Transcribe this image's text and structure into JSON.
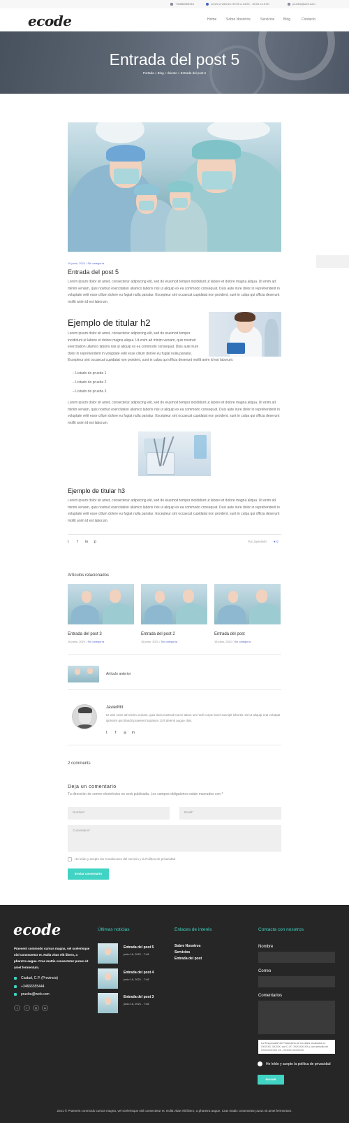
{
  "topbar": {
    "phone": "+34666555444",
    "hours": "Lunes a Viernes: 09:00 a 14:00 - 15:00 a 19:00",
    "email": "prueba@web.com"
  },
  "header": {
    "logo": "ecode",
    "nav": [
      "Home",
      "Sobre Nosotros",
      "Servicios",
      "Blog",
      "Contacto"
    ]
  },
  "hero": {
    "title": "Entrada del post 5",
    "breadcrumb": "Portada » Blog » Ilsiesto » Entrada del post 5"
  },
  "article": {
    "date": "16 junio, 2021",
    "category": "Sin categoría",
    "title": "Entrada del post 5",
    "lorem": "Lorem ipsum dolor sit amet, consectetur adipiscing elit, sed do eiusmod tempor incididunt ut labore et dolore magna aliqua. Ut enim ad minim veniam, quis nostrud exercitation ullamco laboris nisi ut aliquip ex ea commodo consequat. Duis aute irure dolor in reprehenderit in voluptate velit esse cillum dolore eu fugiat nulla pariatur. Excepteur sint occaecat cupidatat non proident, sunt in culpa qui officia deserunt mollit anim id est laborum.",
    "lorem_h2": "Lorem ipsum dolor sit amet, consectetur adipiscing elit, sed do eiusmod tempor incididunt ut labore et dolore magna aliqua. Ut enim ad minim veniam, quis nostrud exercitation ullamco laboris nisi ut aliquip ex ea commodo consequat. Duis aute irure dolor in reprehenderit in voluptate velit esse cillum dolore eu fugiat nulla pariatur. Excepteur sint occaecat cupidatat non proident, sunt in culpa qui officia deserunt mollit anim id est laborum.",
    "h2": "Ejemplo de titular h2",
    "list": [
      "Listado de prueba 1",
      "Listado de prueba 2",
      "Listado de prueba 3"
    ],
    "h3": "Ejemplo de titular h3",
    "author": "Por JavierMrt",
    "comment_count": "0"
  },
  "related": {
    "label": "Artículos relacionados",
    "items": [
      {
        "title": "Entrada del post 3",
        "date": "16 junio, 2021",
        "category": "Sin categoría"
      },
      {
        "title": "Entrada del post 2",
        "date": "16 junio, 2021",
        "category": "Sin categoría"
      },
      {
        "title": "Entrada del post",
        "date": "16 junio, 2021",
        "category": "Sin categoría"
      }
    ]
  },
  "prev": {
    "label": "Artículo anterior"
  },
  "author_box": {
    "name": "JavierMrt",
    "bio": "Ut wisi enim ad minim veniam, quis lacia nostrud exerci tation um hedi corper turet suscipit lobortis nisl ut aliquip erat volutpat ignissim qui blandit praesent luptatum zzril delenit augue duis."
  },
  "comments": {
    "count": "2 comments",
    "reply_title": "Deja un comentario",
    "note": "Tu dirección de correo electrónico no será publicada. Los campos obligatorios están marcados con *",
    "name_placeholder": "Nombre*",
    "email_placeholder": "Email*",
    "comment_placeholder": "Comentario*",
    "consent": "He leído y acepto las Condiciones del servicio y la Política de privacidad",
    "submit": "Enviar comentario"
  },
  "footer": {
    "logo": "ecode",
    "text": "Praesent commodo cursus magna, vel scelerisque nisl consectetur et. Nulla vitae elit libero, a pharetra augue. Cras mattis consectetur purus sit amet fermentum.",
    "city": "Ciudad, C.P. (Provincia)",
    "phone": "+34666555444",
    "email": "prueba@web.com",
    "news_head": "Últimas noticias",
    "news": [
      {
        "title": "Entrada del post 5",
        "date": "junio 16, 2021 - 7:48"
      },
      {
        "title": "Entrada del post 4",
        "date": "junio 16, 2021 - 7:48"
      },
      {
        "title": "Entrada del post 3",
        "date": "junio 16, 2021 - 7:48"
      }
    ],
    "links_head": "Enlaces de interés",
    "links": [
      "Sobre Nosotros",
      "Servicios",
      "Entrada del post"
    ],
    "contact_head": "Contacta con nosotros",
    "contact_labels": [
      "Nombre",
      "Correo",
      "Comentarios"
    ],
    "notice": "La Responsable del Tratamiento de los datos recabados es XXXXXX, XXXXX, con C.I.F.: XXXXXXXXX y con domicilio en XXXXXXXXXX XX - XXXXX XXXXXXX.",
    "consent": "He leído y acepto la política de privacidad",
    "submit": "ENVIAR",
    "copyright": "2021 © Praesent commodo cursus magna, vel scelerisque nisl consectetur et. Nulla vitae elit libero, a pharetra augue. Cras mattis consectetur purus sit amet fermentum."
  },
  "colors": {
    "accent": "#41d3c3",
    "link": "#5b6bc9",
    "footer_bg": "#262626"
  }
}
